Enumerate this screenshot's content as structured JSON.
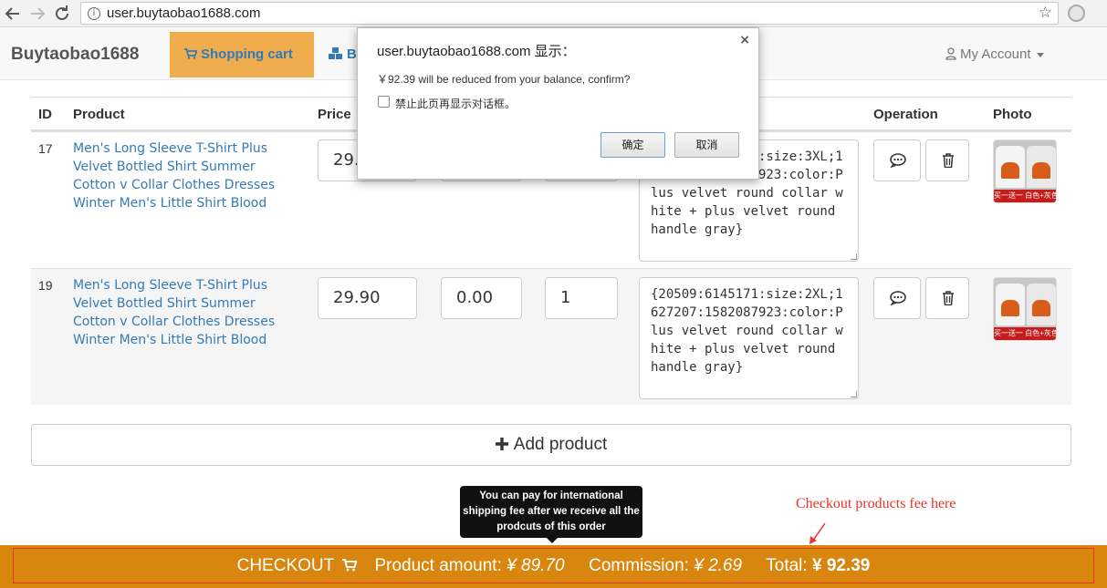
{
  "browser": {
    "url": "user.buytaobao1688.com",
    "info_symbol": "i",
    "bookmark_symbol": "☆"
  },
  "site": {
    "brand": "Buytaobao1688",
    "nav_cart": "Shopping cart",
    "nav_second_partial": "B",
    "account": "My Account"
  },
  "table": {
    "headers": {
      "id": "ID",
      "product": "Product",
      "price": "Price",
      "operation": "Operation",
      "photo": "Photo"
    },
    "rows": [
      {
        "id": "17",
        "product": "Men's Long Sleeve T-Shirt Plus Velvet Bottled Shirt Summer Cotton v Collar Clothes Dresses Winter Men's Little Shirt Blood",
        "price": "29.",
        "shipping": "",
        "quantity": "",
        "note": "{20509:6145171:size:3XL;1627207:1582087923:color:Plus velvet round collar white + plus velvet round handle gray}"
      },
      {
        "id": "19",
        "product": "Men's Long Sleeve T-Shirt Plus Velvet Bottled Shirt Summer Cotton v Collar Clothes Dresses Winter Men's Little Shirt Blood",
        "price": "29.90",
        "shipping": "0.00",
        "quantity": "1",
        "note": "{20509:6145171:size:2XL;1627207:1582087923:color:Plus velvet round collar white + plus velvet round handle gray}"
      }
    ],
    "photo_caption": "买一送一 白色+灰色"
  },
  "add_product": "Add product",
  "tooltip": "You can pay for international shipping fee after we receive all the prodcuts of this order",
  "annotation": "Checkout products fee here",
  "checkout": {
    "label": "CHECKOUT",
    "product_amount_label": "Product amount:",
    "product_amount_value": "¥ 89.70",
    "commission_label": "Commission:",
    "commission_value": "¥ 2.69",
    "total_label": "Total:",
    "total_value": "¥ 92.39"
  },
  "dialog": {
    "title": "user.buytaobao1688.com 显示：",
    "close": "×",
    "message": "￥92.39 will be reduced from your balance, confirm?",
    "checkbox_label": "禁止此页再显示对话框。",
    "ok": "确定",
    "cancel": "取消"
  },
  "colors": {
    "accent_orange": "#f0ad4e",
    "checkout_bar": "#d9860f",
    "link_blue": "#337ab7",
    "annotation_red": "#e8322b"
  }
}
